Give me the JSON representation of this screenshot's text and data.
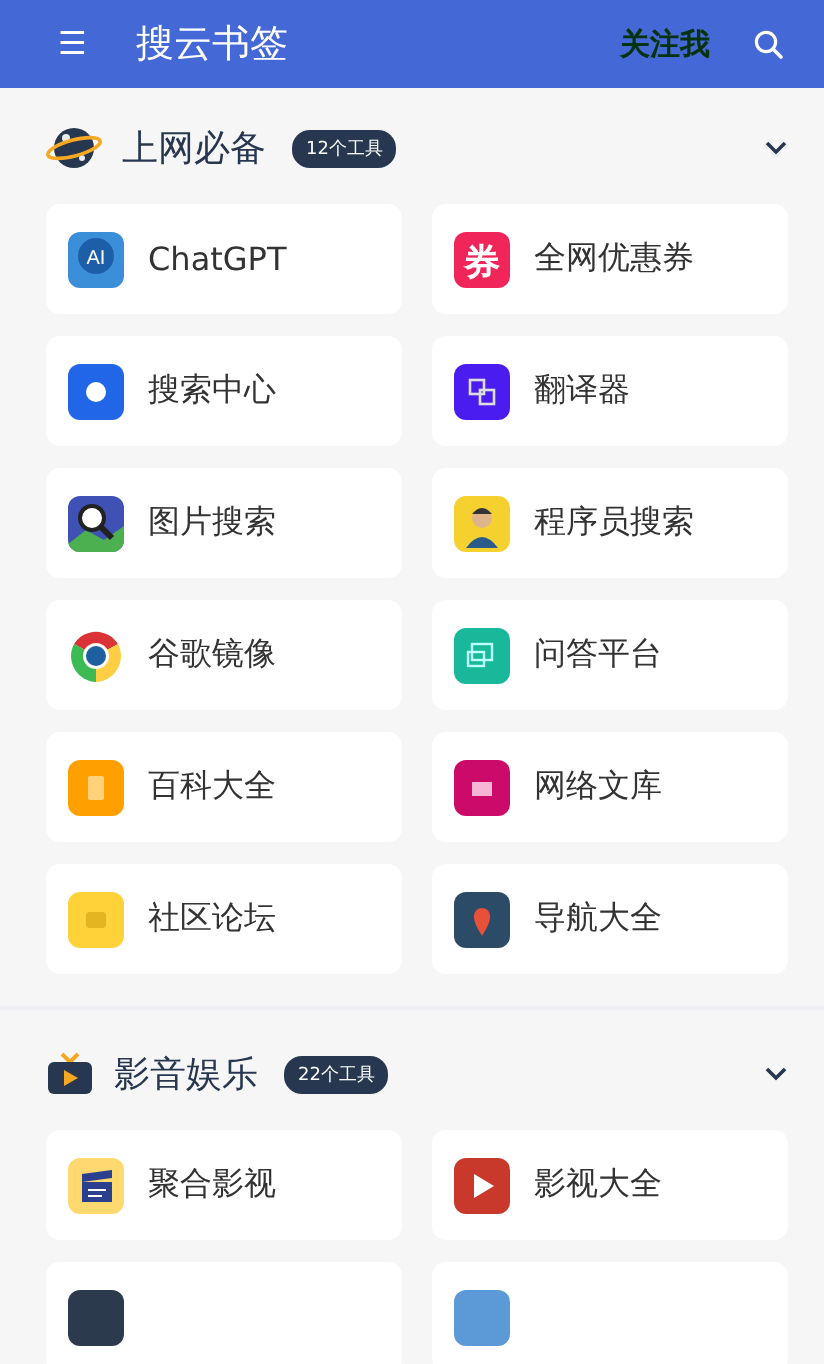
{
  "header": {
    "menu_icon": "☰",
    "title": "搜云书签",
    "follow": "关注我"
  },
  "sections": [
    {
      "kind": "planet",
      "title": "上网必备",
      "count": "12个工具",
      "expanded": true,
      "items": [
        {
          "kind": "ai",
          "icon_text": "AI",
          "label": "ChatGPT"
        },
        {
          "kind": "coupon",
          "icon_text": "券",
          "label": "全网优惠券"
        },
        {
          "kind": "dot",
          "label": "搜索中心"
        },
        {
          "kind": "translate",
          "label": "翻译器"
        },
        {
          "kind": "image-search",
          "label": "图片搜索"
        },
        {
          "kind": "person",
          "label": "程序员搜索"
        },
        {
          "kind": "chrome",
          "label": "谷歌镜像"
        },
        {
          "kind": "chat",
          "label": "问答平台"
        },
        {
          "kind": "book",
          "label": "百科大全"
        },
        {
          "kind": "printer",
          "label": "网络文库"
        },
        {
          "kind": "forum",
          "label": "社区论坛"
        },
        {
          "kind": "pin",
          "label": "导航大全"
        }
      ]
    },
    {
      "kind": "tv",
      "title": "影音娱乐",
      "count": "22个工具",
      "expanded": true,
      "items": [
        {
          "kind": "clapper",
          "label": "聚合影视"
        },
        {
          "kind": "play",
          "label": "影视大全"
        },
        {
          "kind": "dark"
        },
        {
          "kind": "blue"
        }
      ]
    }
  ]
}
